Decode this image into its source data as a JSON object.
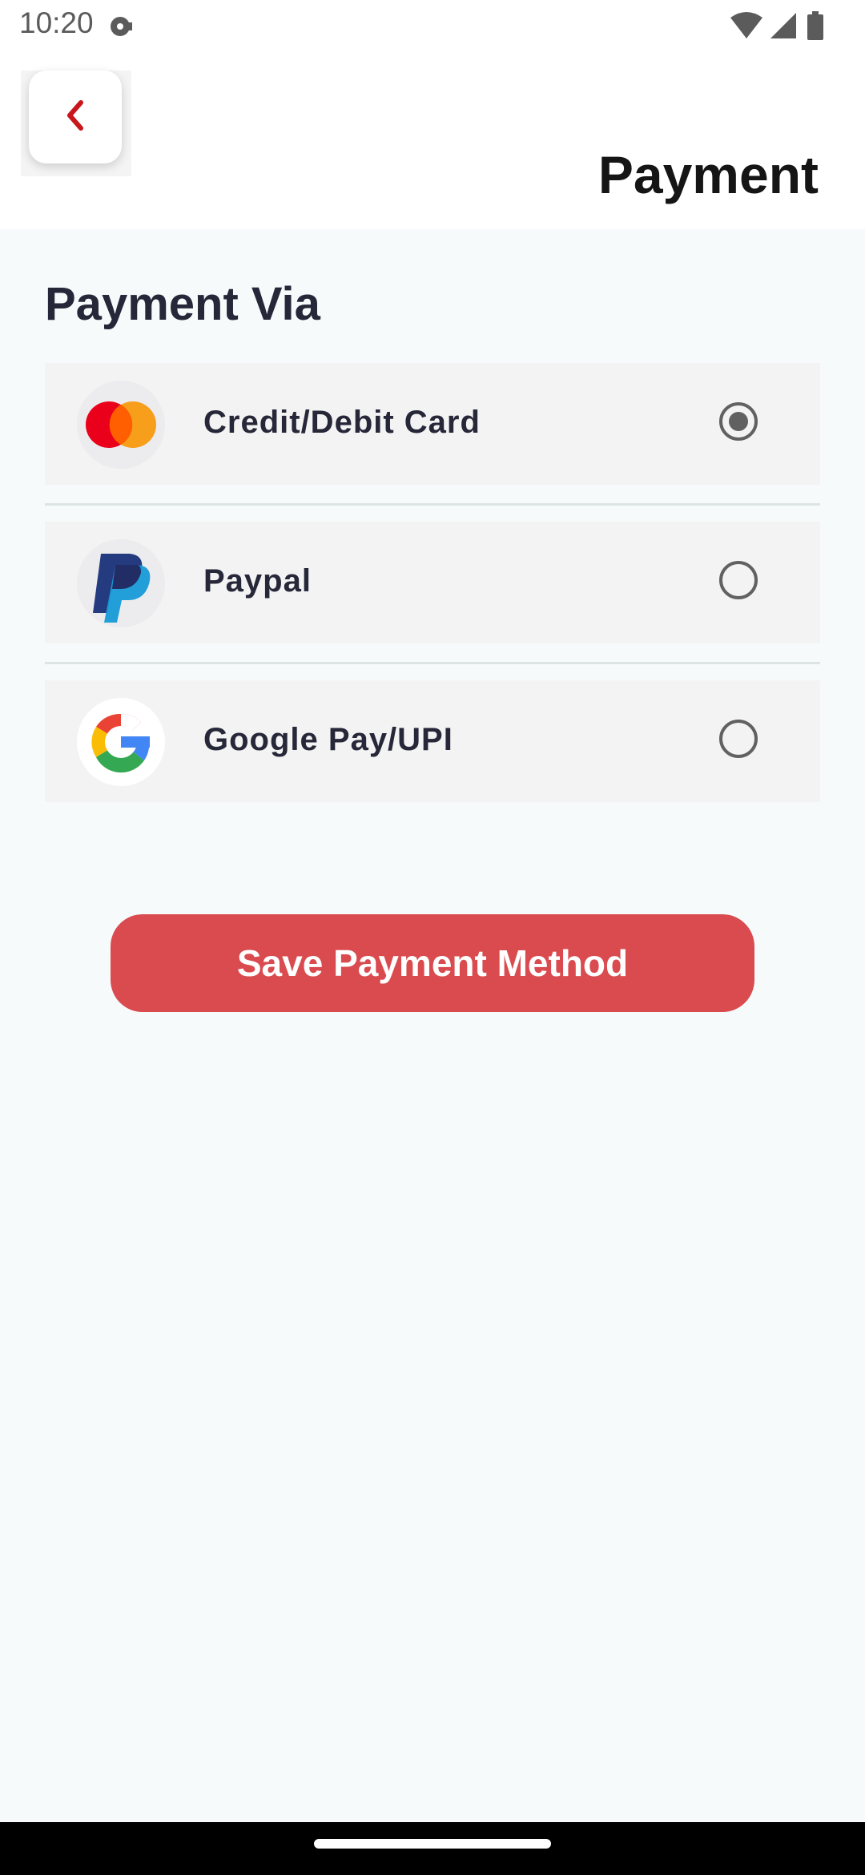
{
  "status_bar": {
    "time": "10:20",
    "icons": [
      "media-dot-icon",
      "wifi-icon",
      "signal-icon",
      "battery-icon"
    ]
  },
  "header": {
    "title": "Payment",
    "back_icon": "chevron-left-icon",
    "accent_color": "#c8161d"
  },
  "section": {
    "title": "Payment Via"
  },
  "payment_options": [
    {
      "label": "Credit/Debit Card",
      "icon": "mastercard-icon",
      "selected": true
    },
    {
      "label": "Paypal",
      "icon": "paypal-icon",
      "selected": false
    },
    {
      "label": "Google Pay/UPI",
      "icon": "google-icon",
      "selected": false
    }
  ],
  "actions": {
    "save_label": "Save Payment Method",
    "save_color": "#d94b4f"
  }
}
